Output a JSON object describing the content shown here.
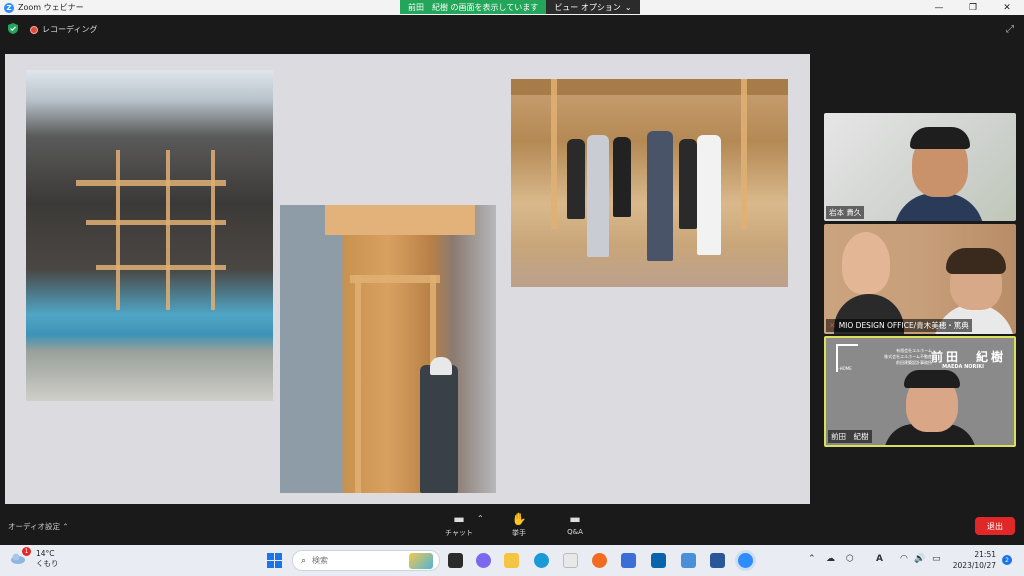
{
  "window": {
    "logo": "Z",
    "title": "Zoom ウェビナー",
    "minimize": "—",
    "restore": "❐",
    "close": "✕"
  },
  "share_banner": {
    "text": "前田　紀樹 の画面を表示しています",
    "view_options": "ビュー オプション",
    "chevron": "⌄"
  },
  "meeting_top": {
    "recording": "レコーディング",
    "fullscreen_icon": "⤢"
  },
  "participants": [
    {
      "name": "岩本 貴久",
      "muted": false
    },
    {
      "name": "MIO DESIGN OFFICE/青木美穂・篤典",
      "muted": true
    },
    {
      "name": "前田　紀樹",
      "muted": false,
      "banner": {
        "name": "前田　紀樹",
        "roman": "MAEDA NORIKI",
        "company": "有限会社エルホーム\n株式会社エルホーム不動産\n前田建築設計事務所",
        "logo_text": "L-HOME"
      }
    }
  ],
  "toolbar": {
    "audio_settings": "オーディオ設定",
    "audio_chevron": "⌃",
    "chat": "チャット",
    "chat_chevron": "⌃",
    "raise_hand": "挙手",
    "qa": "Q&A",
    "leave": "退出",
    "chat_icon": "▬",
    "hand_icon": "✋",
    "qa_icon": "▬"
  },
  "taskbar": {
    "weather_temp": "14°C",
    "weather_desc": "くもり",
    "weather_badge": "1",
    "search_placeholder": "検索",
    "search_icon": "⌕",
    "time": "21:51",
    "date": "2023/10/27",
    "notification_count": "2",
    "tray_icons": [
      "⌃",
      "☁",
      "⬡",
      "A",
      "◠",
      "🔊",
      "▭"
    ]
  },
  "colors": {
    "share_green": "#23a55a",
    "leave_red": "#e02828",
    "active_speaker": "#d9e05a"
  }
}
